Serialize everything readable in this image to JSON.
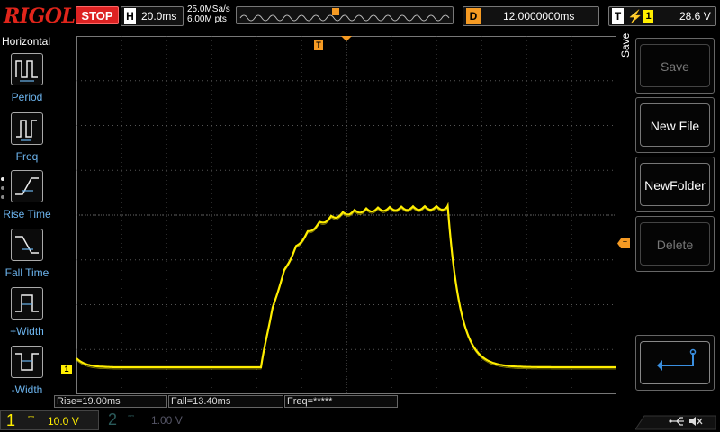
{
  "brand": "RIGOL",
  "run_state": "STOP",
  "horizontal": {
    "key": "H",
    "timebase": "20.0ms"
  },
  "acquisition": {
    "sample_rate": "25.0MSa/s",
    "memory_depth": "6.00M pts"
  },
  "delay": {
    "key": "D",
    "value": "12.0000000ms"
  },
  "trigger": {
    "key": "T",
    "source": "1",
    "level": "28.6 V"
  },
  "left_menu": {
    "title": "Horizontal",
    "items": [
      {
        "label": "Period",
        "icon": "period-icon"
      },
      {
        "label": "Freq",
        "icon": "frequency-icon"
      },
      {
        "label": "Rise Time",
        "icon": "rise-time-icon"
      },
      {
        "label": "Fall Time",
        "icon": "fall-time-icon"
      },
      {
        "label": "+Width",
        "icon": "positive-width-icon"
      },
      {
        "label": "-Width",
        "icon": "negative-width-icon"
      }
    ]
  },
  "markers": {
    "trigger": "T",
    "channel1": "1",
    "trigger_level": "T"
  },
  "measurements": [
    {
      "text": "Rise=19.00ms"
    },
    {
      "text": "Fall=13.40ms"
    },
    {
      "text": "Freq=*****"
    }
  ],
  "right_menu": {
    "title": "Save",
    "buttons": [
      {
        "label": "Save",
        "enabled": false
      },
      {
        "label": "New File",
        "enabled": true
      },
      {
        "label": "NewFolder",
        "enabled": true
      },
      {
        "label": "Delete",
        "enabled": false
      },
      {
        "label": "",
        "icon": "return-arrow-icon",
        "enabled": true
      }
    ]
  },
  "channels": [
    {
      "num": "1",
      "coupling": "",
      "scale": "10.0 V",
      "active": true
    },
    {
      "num": "2",
      "coupling": "",
      "scale": "1.00 V",
      "active": false
    }
  ],
  "colors": {
    "ch1": "#ffee00",
    "trigger": "#f59a23",
    "grid": "#555555",
    "menu_label": "#6cb4ee"
  },
  "waveform": {
    "channel": "1",
    "baseline_divisions": 0,
    "high_level_divisions": 3.6,
    "rise_start_divisions": 4.1,
    "plateau_end_divisions": 8.25,
    "note_units": "divisions"
  }
}
